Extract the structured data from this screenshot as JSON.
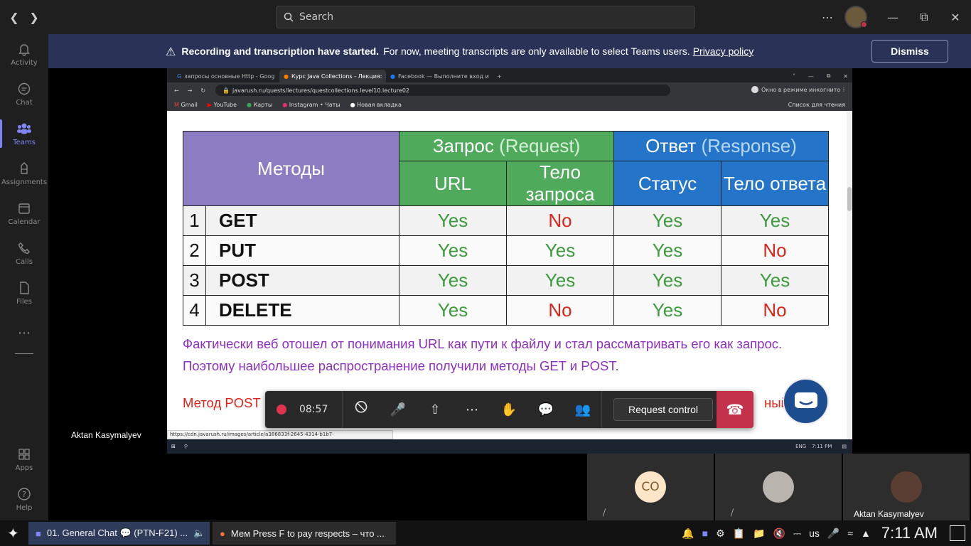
{
  "search": {
    "placeholder": "Search"
  },
  "rail": [
    {
      "label": "Activity",
      "icon": "bell-icon"
    },
    {
      "label": "Chat",
      "icon": "chat-icon"
    },
    {
      "label": "Teams",
      "icon": "teams-icon"
    },
    {
      "label": "Assignments",
      "icon": "assignments-icon"
    },
    {
      "label": "Calendar",
      "icon": "calendar-icon"
    },
    {
      "label": "Calls",
      "icon": "phone-icon"
    },
    {
      "label": "Files",
      "icon": "file-icon"
    }
  ],
  "rail_bottom": [
    {
      "label": "Apps"
    },
    {
      "label": "Help"
    }
  ],
  "banner": {
    "bold": "Recording and transcription have started.",
    "text": "For now, meeting transcripts are only available to select Teams users.",
    "link": "Privacy policy",
    "dismiss": "Dismiss"
  },
  "browser": {
    "tabs": [
      "запросы основные Http - Goog",
      "Курс Java Collections - Лекция:",
      "Facebook — Выполните вход и"
    ],
    "url": "javarush.ru/quests/lectures/questcollections.level10.lecture02",
    "incognito": "Окно в режиме инкогнито",
    "bookmarks": [
      "Gmail",
      "YouTube",
      "Карты",
      "Instagram • Чаты",
      "Новая вкладка"
    ],
    "reading_list": "Список для чтения",
    "status_url": "https://cdn.javarush.ru/images/article/a386833f-2645-4314-b1b7-079ca47fbab2/original.jpeg",
    "win_time": "7:11 PM",
    "win_lang": "ENG"
  },
  "table": {
    "methods_header": "Методы",
    "request": {
      "title": "Запрос",
      "en": "(Request)",
      "cols": [
        "URL",
        "Тело запроса"
      ]
    },
    "response": {
      "title": "Ответ",
      "en": "(Response)",
      "cols": [
        "Статус",
        "Тело ответа"
      ]
    },
    "rows": [
      {
        "n": "1",
        "method": "GET",
        "cells": [
          "Yes",
          "No",
          "Yes",
          "Yes"
        ]
      },
      {
        "n": "2",
        "method": "PUT",
        "cells": [
          "Yes",
          "Yes",
          "Yes",
          "No"
        ]
      },
      {
        "n": "3",
        "method": "POST",
        "cells": [
          "Yes",
          "Yes",
          "Yes",
          "Yes"
        ]
      },
      {
        "n": "4",
        "method": "DELETE",
        "cells": [
          "Yes",
          "No",
          "Yes",
          "No"
        ]
      }
    ]
  },
  "para1": "Фактически веб отошел от понимания URL как пути к файлу и стал рассматривать его как запрос.",
  "para2": "Поэтому наибольшее распространение получили методы GET и POST.",
  "para3_start": "Метод POST",
  "para3_end": "ный с",
  "controls": {
    "timer": "08:57",
    "request_control": "Request control"
  },
  "presenter": "Aktan Kasymalyev",
  "participants": [
    {
      "initials": "CO"
    },
    {
      "initials": ""
    },
    {
      "initials": "",
      "name": "Aktan Kasymalyev"
    }
  ],
  "taskbar": {
    "items": [
      "01. General Chat 💬 (PTN-F21) ...",
      "Мем Press F to pay respects – что ..."
    ],
    "lang": "us",
    "time": "7:11 AM"
  }
}
